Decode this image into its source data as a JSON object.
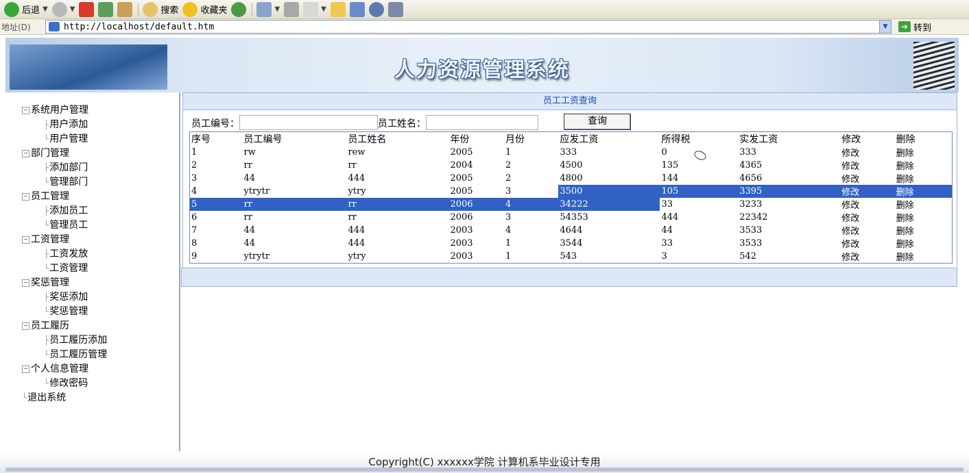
{
  "toolbar": {
    "back": "后退",
    "search": "搜索",
    "favorites": "收藏夹"
  },
  "address": {
    "label": "地址(D)",
    "url": "http://localhost/default.htm",
    "go": "转到"
  },
  "banner": {
    "title": "人力资源管理系统"
  },
  "sidebar": {
    "groups": [
      {
        "label": "系统用户管理",
        "items": [
          "用户添加",
          "用户管理"
        ]
      },
      {
        "label": "部门管理",
        "items": [
          "添加部门",
          "管理部门"
        ]
      },
      {
        "label": "员工管理",
        "items": [
          "添加员工",
          "管理员工"
        ]
      },
      {
        "label": "工资管理",
        "items": [
          "工资发放",
          "工资管理"
        ]
      },
      {
        "label": "奖惩管理",
        "items": [
          "奖惩添加",
          "奖惩管理"
        ]
      },
      {
        "label": "员工履历",
        "items": [
          "员工履历添加",
          "员工履历管理"
        ]
      },
      {
        "label": "个人信息管理",
        "items": [
          "修改密码"
        ]
      }
    ],
    "logout": "退出系统"
  },
  "query": {
    "title": "员工工资查询",
    "emp_no_label": "员工编号：",
    "emp_name_label": "员工姓名：",
    "emp_no_value": "",
    "emp_name_value": "",
    "button": "查询"
  },
  "table": {
    "headers": [
      "序号",
      "员工编号",
      "员工姓名",
      "年份",
      "月份",
      "应发工资",
      "所得税",
      "实发工资",
      "修改",
      "删除"
    ],
    "rows": [
      [
        "1",
        "rw",
        "rew",
        "2005",
        "1",
        "333",
        "0",
        "333",
        "修改",
        "删除"
      ],
      [
        "2",
        "rr",
        "rr",
        "2004",
        "2",
        "4500",
        "135",
        "4365",
        "修改",
        "删除"
      ],
      [
        "3",
        "44",
        "444",
        "2005",
        "2",
        "4800",
        "144",
        "4656",
        "修改",
        "删除"
      ],
      [
        "4",
        "ytrytr",
        "ytry",
        "2005",
        "3",
        "3500",
        "105",
        "3395",
        "修改",
        "删除"
      ],
      [
        "5",
        "rr",
        "rr",
        "2006",
        "4",
        "34222",
        "33",
        "3233",
        "修改",
        "删除"
      ],
      [
        "6",
        "rr",
        "rr",
        "2006",
        "3",
        "54353",
        "444",
        "22342",
        "修改",
        "删除"
      ],
      [
        "7",
        "44",
        "444",
        "2003",
        "4",
        "4644",
        "44",
        "3533",
        "修改",
        "删除"
      ],
      [
        "8",
        "44",
        "444",
        "2003",
        "1",
        "3544",
        "33",
        "3533",
        "修改",
        "删除"
      ],
      [
        "9",
        "ytrytr",
        "ytry",
        "2003",
        "1",
        "543",
        "3",
        "542",
        "修改",
        "删除"
      ]
    ]
  },
  "footer": {
    "text": "Copyright(C) xxxxxx学院 计算机系毕业设计专用"
  }
}
